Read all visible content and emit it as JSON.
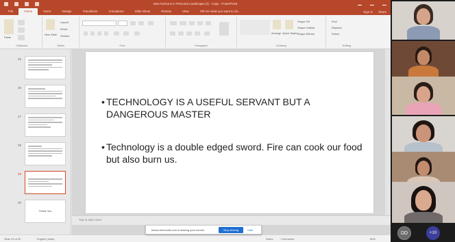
{
  "titlebar": {
    "title": "New horizons in Personal Landscape (2) - Copy - PowerPoint"
  },
  "ribbon_tabs": [
    "File",
    "Home",
    "Insert",
    "Design",
    "Transitions",
    "Animations",
    "Slide Show",
    "Review",
    "View",
    "Tell me what you want to do..."
  ],
  "ribbon_right": {
    "signin": "Sign in",
    "share": "Share"
  },
  "ribbon": {
    "paste": "Paste",
    "new_slide": "New Slide",
    "layout": "Layout",
    "reset": "Reset",
    "section": "Section",
    "arrange": "Arrange",
    "quick_styles": "Quick Styles",
    "shape_fill": "Shape Fill",
    "shape_outline": "Shape Outline",
    "shape_effects": "Shape Effects",
    "find": "Find",
    "replace": "Replace",
    "select": "Select",
    "groups": {
      "clipboard": "Clipboard",
      "slides": "Slides",
      "font": "Font",
      "paragraph": "Paragraph",
      "drawing": "Drawing",
      "editing": "Editing"
    }
  },
  "thumbnails": [
    {
      "num": "25"
    },
    {
      "num": "26"
    },
    {
      "num": "27"
    },
    {
      "num": "28"
    },
    {
      "num": "29",
      "selected": true
    },
    {
      "num": "30",
      "text": "Thank You"
    }
  ],
  "slide": {
    "bullets": [
      "TECHNOLOGY IS A USEFUL SERVANT BUT A DANGEROUS MASTER",
      "Technology is a double edged sword. Fire can cook our food but also burn us."
    ]
  },
  "notes_placeholder": "Tap to add notes",
  "status": {
    "slide_count": "Slide 29 of 30",
    "language": "English (India)",
    "notes": "Notes",
    "comments": "Comments",
    "zoom": "69%"
  },
  "sharebar": {
    "message": "teams.microsoft.com is sharing your screen.",
    "stop": "Stop sharing",
    "hide": "Hide"
  },
  "participants": {
    "avatar_initials": "DD",
    "more_count": "+10"
  },
  "colors": {
    "accent": "#b7472a",
    "share_blue": "#1f6fd1",
    "more_bg": "#3b3f9c"
  }
}
